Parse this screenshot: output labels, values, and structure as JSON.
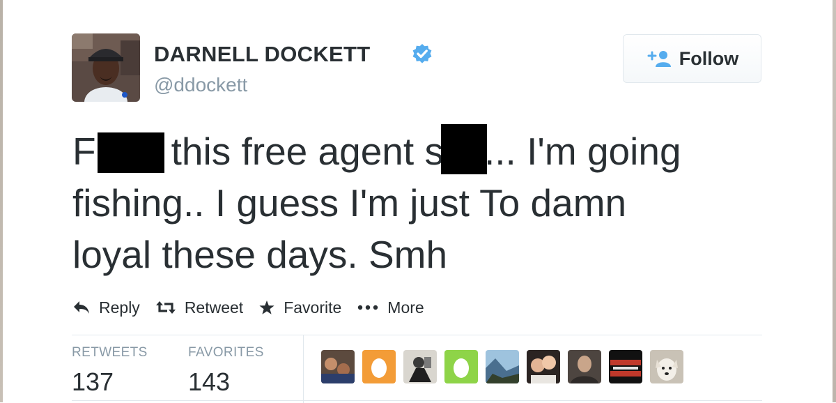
{
  "user": {
    "name": "DARNELL DOCKETT",
    "handle": "@ddockett",
    "verified": true,
    "avatar_icon": "user-avatar-photo"
  },
  "follow_button": {
    "label": "Follow",
    "icon": "add-user-icon"
  },
  "tweet": {
    "line1": {
      "a": "F",
      "b": "this free agent s",
      "c": "... I'm going"
    },
    "line2": "fishing.. I guess I'm just To damn",
    "line3": "loyal these days. Smh"
  },
  "actions": {
    "reply": "Reply",
    "retweet": "Retweet",
    "favorite": "Favorite",
    "more": "More"
  },
  "stats": {
    "retweets_label": "RETWEETS",
    "retweets_value": "137",
    "favorites_label": "FAVORITES",
    "favorites_value": "143"
  },
  "colors": {
    "text": "#292f33",
    "muted": "#8899a6",
    "verified_blue": "#55acee",
    "border": "#e1e8ed"
  },
  "favoriters": [
    {
      "icon": "group-photo-avatar"
    },
    {
      "icon": "default-egg-avatar-orange"
    },
    {
      "icon": "black-white-photo-avatar"
    },
    {
      "icon": "default-egg-avatar-green"
    },
    {
      "icon": "landscape-photo-avatar"
    },
    {
      "icon": "couple-photo-avatar"
    },
    {
      "icon": "portrait-photo-avatar"
    },
    {
      "icon": "honey-badger-logo-avatar"
    },
    {
      "icon": "dog-photo-avatar"
    }
  ]
}
